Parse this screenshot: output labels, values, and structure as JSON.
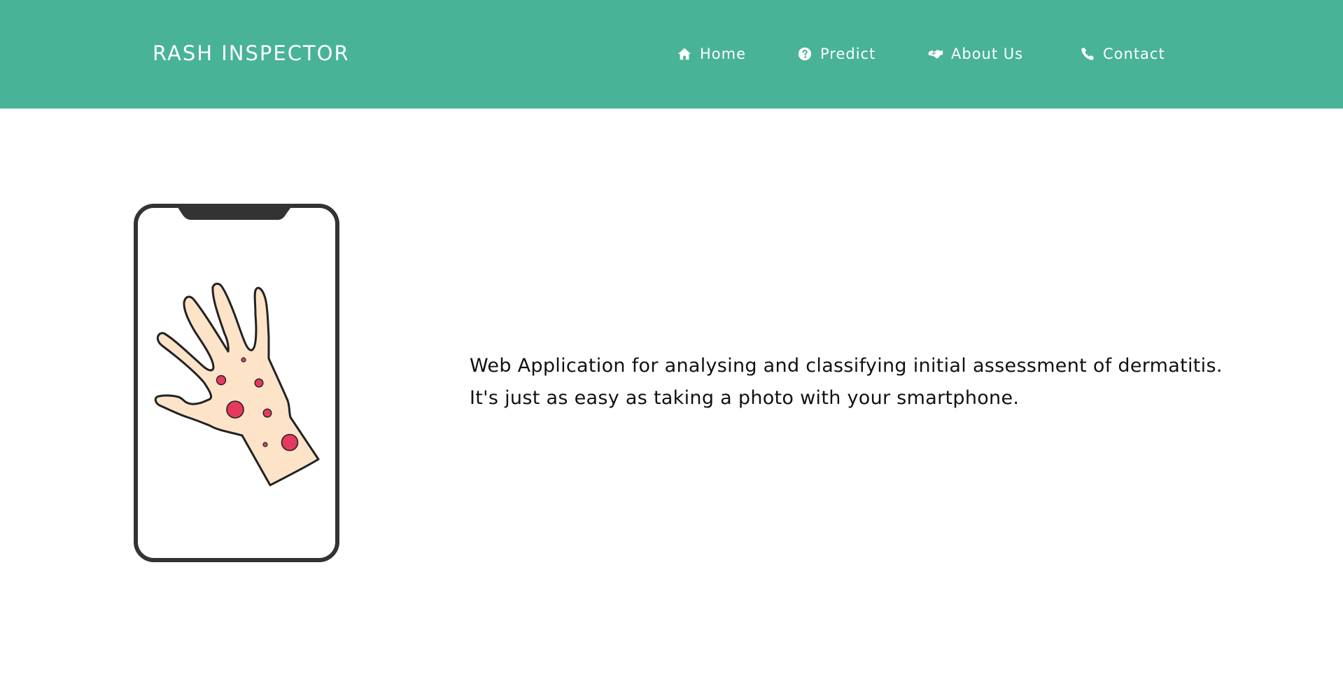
{
  "brand": {
    "title": "RASH INSPECTOR"
  },
  "nav": {
    "items": [
      {
        "label": "Home",
        "icon": "home-icon"
      },
      {
        "label": "Predict",
        "icon": "question-circle-icon"
      },
      {
        "label": "About Us",
        "icon": "handshake-icon"
      },
      {
        "label": "Contact",
        "icon": "phone-icon"
      }
    ]
  },
  "hero": {
    "line1": "Web Application for analysing and classifying initial assessment of dermatitis.",
    "line2": "It's just as easy as taking a photo with your smartphone.",
    "illustration_icon": "smartphone-rash-hand-illustration"
  },
  "colors": {
    "navbar_bg": "#48b396",
    "nav_text": "#ffffff",
    "body_text": "#111111",
    "phone_frame": "#333333",
    "skin": "#fde3c8",
    "rash": "#e6395f"
  }
}
